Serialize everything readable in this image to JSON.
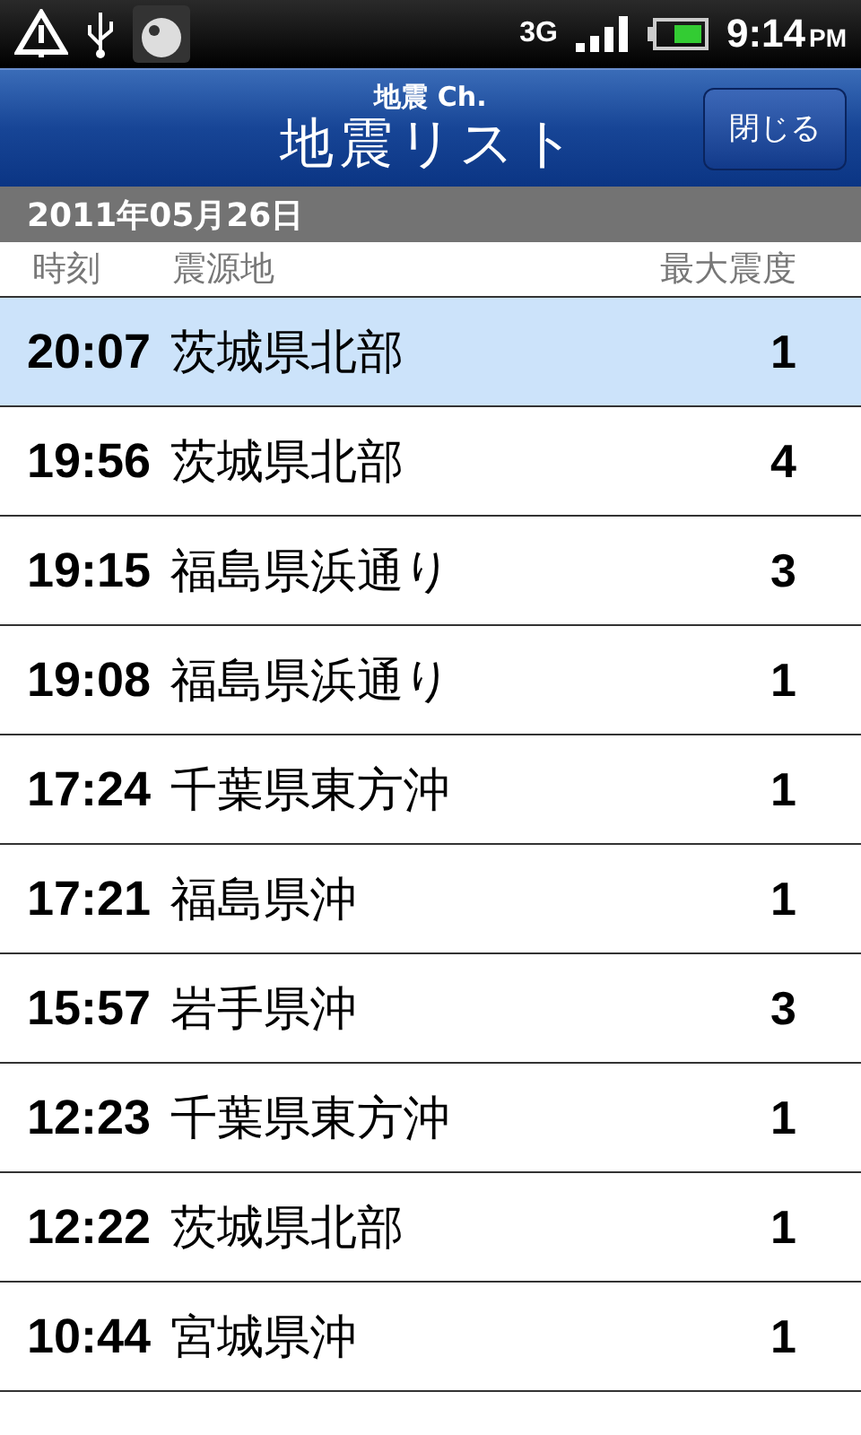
{
  "status_bar": {
    "network": "3G",
    "time": "9:14",
    "meridiem": "PM"
  },
  "header": {
    "subtitle": "地震 Ch.",
    "title": "地震リスト",
    "close_button": "閉じる"
  },
  "date": "2011年05月26日",
  "columns": [
    "時刻",
    "震源地",
    "最大震度"
  ],
  "rows": [
    {
      "time": "20:07",
      "place": "茨城県北部",
      "intensity": "1",
      "selected": true
    },
    {
      "time": "19:56",
      "place": "茨城県北部",
      "intensity": "4",
      "selected": false
    },
    {
      "time": "19:15",
      "place": "福島県浜通り",
      "intensity": "3",
      "selected": false
    },
    {
      "time": "19:08",
      "place": "福島県浜通り",
      "intensity": "1",
      "selected": false
    },
    {
      "time": "17:24",
      "place": "千葉県東方沖",
      "intensity": "1",
      "selected": false
    },
    {
      "time": "17:21",
      "place": "福島県沖",
      "intensity": "1",
      "selected": false
    },
    {
      "time": "15:57",
      "place": "岩手県沖",
      "intensity": "3",
      "selected": false
    },
    {
      "time": "12:23",
      "place": "千葉県東方沖",
      "intensity": "1",
      "selected": false
    },
    {
      "time": "12:22",
      "place": "茨城県北部",
      "intensity": "1",
      "selected": false
    },
    {
      "time": "10:44",
      "place": "宮城県沖",
      "intensity": "1",
      "selected": false
    }
  ]
}
